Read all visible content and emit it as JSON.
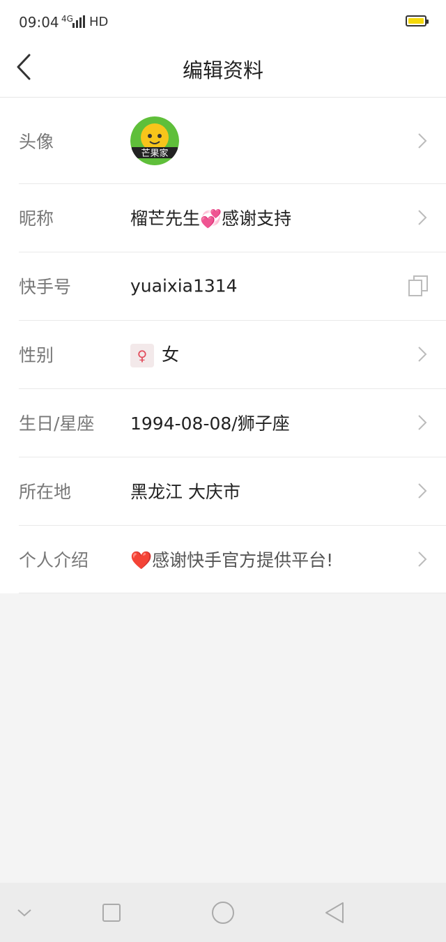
{
  "status_bar": {
    "time": "09:04",
    "network": "4G",
    "hd": "HD",
    "battery_level": 0.8,
    "battery_color": "#f5d90a"
  },
  "header": {
    "title": "编辑资料",
    "back_icon": "chevron-left-icon"
  },
  "profile": {
    "avatar": {
      "label": "头像",
      "logo_text": "芒果家"
    },
    "nickname": {
      "label": "昵称",
      "value": "榴芒先生💞感谢支持"
    },
    "kuaishou_id": {
      "label": "快手号",
      "value": "yuaixia1314",
      "icon": "copy-icon"
    },
    "gender": {
      "label": "性别",
      "value": "女",
      "icon": "female-icon"
    },
    "birthday": {
      "label": "生日/星座",
      "value": "1994-08-08/狮子座"
    },
    "location": {
      "label": "所在地",
      "value": "黑龙江 大庆市"
    },
    "intro": {
      "label": "个人介绍",
      "heart": "❤️",
      "value": "感谢快手官方提供平台!"
    }
  },
  "nav_bar": {
    "icons": [
      "chevron-down-icon",
      "square-icon",
      "circle-icon",
      "triangle-back-icon"
    ]
  }
}
